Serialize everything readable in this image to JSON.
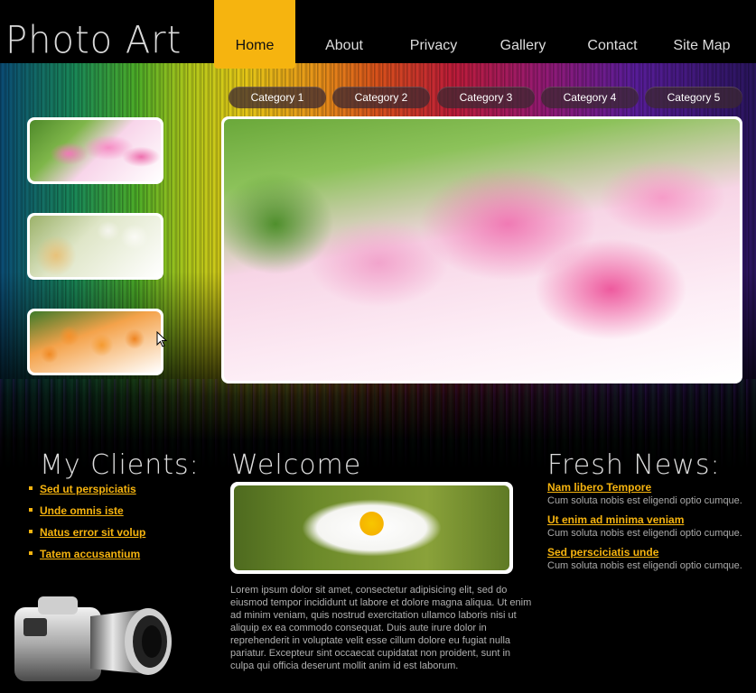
{
  "logo": "Photo Art",
  "nav": [
    {
      "label": "Home",
      "active": true
    },
    {
      "label": "About"
    },
    {
      "label": "Privacy"
    },
    {
      "label": "Gallery"
    },
    {
      "label": "Contact"
    },
    {
      "label": "Site Map"
    }
  ],
  "categories": [
    "Category 1",
    "Category 2",
    "Category 3",
    "Category 4",
    "Category 5"
  ],
  "clients": {
    "title": "My Clients:",
    "items": [
      "Sed ut perspiciatis",
      "Unde omnis iste",
      "Natus error sit volup",
      "Tatem accusantium"
    ]
  },
  "welcome": {
    "title": "Welcome",
    "text": "Lorem ipsum dolor sit amet, consectetur adipisicing elit, sed do eiusmod tempor incididunt ut labore et dolore magna aliqua. Ut enim ad minim veniam, quis nostrud exercitation ullamco laboris nisi ut aliquip ex ea commodo consequat. Duis aute irure dolor in reprehenderit in voluptate velit esse cillum dolore eu fugiat nulla pariatur. Excepteur sint occaecat cupidatat non proident, sunt in culpa qui officia deserunt mollit anim id est laborum."
  },
  "news": {
    "title": "Fresh News:",
    "items": [
      {
        "title": "Nam libero Tempore",
        "text": "Cum soluta nobis est eligendi optio cumque."
      },
      {
        "title": "Ut enim ad minima veniam",
        "text": "Cum soluta nobis est eligendi optio cumque."
      },
      {
        "title": "Sed persciciatis unde",
        "text": "Cum soluta nobis est eligendi optio cumque."
      }
    ]
  },
  "colors": {
    "accent": "#f6b40f",
    "background": "#000000"
  }
}
